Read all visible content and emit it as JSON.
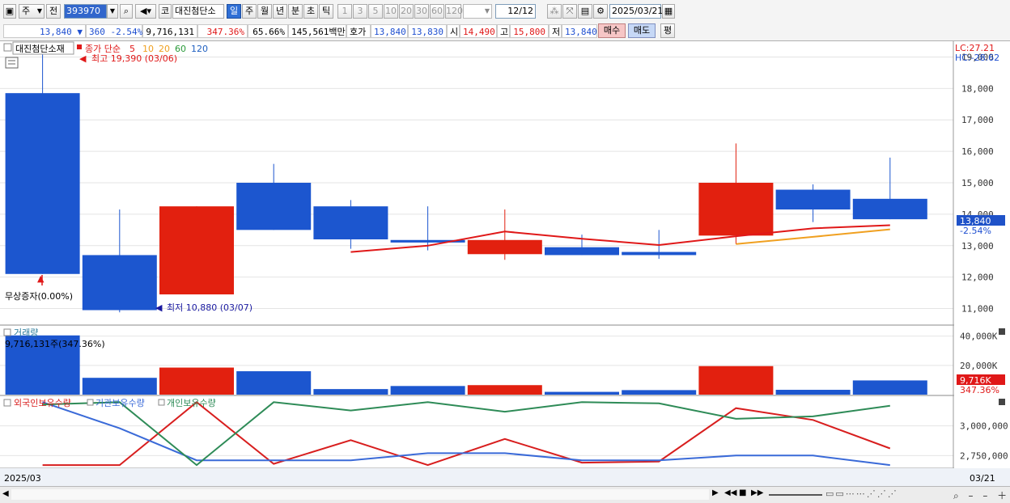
{
  "toolbar": {
    "unit_label": "주",
    "prev_label": "전",
    "code": "393970",
    "stock_name": "대진첨단소",
    "market_btn": "코",
    "periods": [
      "일",
      "주",
      "월",
      "년",
      "분",
      "초",
      "틱"
    ],
    "active_period": "일",
    "intervals": [
      "1",
      "3",
      "5",
      "10",
      "20",
      "30",
      "60",
      "120"
    ],
    "count": "12",
    "count_total": "/12",
    "date": "2025/03/21"
  },
  "quote": {
    "price": "13,840",
    "change_arrow": "▼",
    "change": "360",
    "change_pct": "-2.54%",
    "volume": "9,716,131",
    "volume_pct": "347.36%",
    "ratio": "65.66%",
    "amount": "145,561백만",
    "hoga_label": "호가",
    "ask": "13,840",
    "bid": "13,830",
    "open_label": "시",
    "open": "14,490",
    "high_label": "고",
    "high": "15,800",
    "low_label": "저",
    "low": "13,840",
    "buy_label": "매수",
    "sell_label": "매도",
    "eval_label": "평"
  },
  "price_panel": {
    "name_tag": "대진첨단소재",
    "ma_title": "종가 단순",
    "ma_periods": [
      "5",
      "10",
      "20",
      "60",
      "120"
    ],
    "ma_colors": [
      "#e01818",
      "#f0a020",
      "#f0a020",
      "#2a9a3a",
      "#2060c0"
    ],
    "high_note": "최고 19,390 (03/06)",
    "low_note": "최저 10,880 (03/07)",
    "event_note": "무상증자(0.00%)",
    "lc": "LC:27.21",
    "hc": "HC:-28.62",
    "last_price_tag": "13,840",
    "last_pct_tag": "-2.54%"
  },
  "volume_panel": {
    "title": "거래량",
    "info": "9,716,131주(347.36%)",
    "last_tag": "9,716K",
    "last_pct": "347.36%"
  },
  "holding_panel": {
    "series_labels": [
      "외국인보유수량",
      "기관보유수량",
      "개인보유수량"
    ],
    "colors": [
      "#d81e1e",
      "#3a6ad8",
      "#2e8b57"
    ]
  },
  "axis": {
    "left_date": "2025/03",
    "right_date": "03/21"
  },
  "chart_data": [
    {
      "type": "candlestick",
      "title": "대진첨단소재",
      "ylim": [
        10500,
        19500
      ],
      "yticks": [
        11000,
        12000,
        13000,
        14000,
        15000,
        16000,
        17000,
        18000,
        19000
      ],
      "ytick_labels": [
        "11,000",
        "12,000",
        "13,000",
        "14,000",
        "15,000",
        "16,000",
        "17,000",
        "18,000",
        "19,000"
      ],
      "candles": [
        {
          "open": 17850,
          "high": 19390,
          "low": 12100,
          "close": 12100,
          "up": false
        },
        {
          "open": 12700,
          "high": 14150,
          "low": 10880,
          "close": 10950,
          "up": false
        },
        {
          "open": 11450,
          "high": 14250,
          "low": 11450,
          "close": 14250,
          "up": true
        },
        {
          "open": 15000,
          "high": 15600,
          "low": 13500,
          "close": 13500,
          "up": false
        },
        {
          "open": 14250,
          "high": 14450,
          "low": 12900,
          "close": 13200,
          "up": false
        },
        {
          "open": 13180,
          "high": 14250,
          "low": 12850,
          "close": 13100,
          "up": false
        },
        {
          "open": 12730,
          "high": 14150,
          "low": 12550,
          "close": 13180,
          "up": true
        },
        {
          "open": 12950,
          "high": 13350,
          "low": 12700,
          "close": 12700,
          "up": false
        },
        {
          "open": 12800,
          "high": 13500,
          "low": 12580,
          "close": 12700,
          "up": false
        },
        {
          "open": 13320,
          "high": 16250,
          "low": 13050,
          "close": 15000,
          "up": true
        },
        {
          "open": 14780,
          "high": 14950,
          "low": 13750,
          "close": 14150,
          "up": false
        },
        {
          "open": 14490,
          "high": 15800,
          "low": 13840,
          "close": 13840,
          "up": false
        }
      ],
      "ma5": [
        null,
        null,
        null,
        null,
        12800,
        13000,
        13450,
        13220,
        13020,
        13300,
        13550,
        13650
      ],
      "ma10": [
        null,
        null,
        null,
        null,
        null,
        null,
        null,
        null,
        null,
        13050,
        13280,
        13520
      ]
    },
    {
      "type": "bar",
      "title": "거래량",
      "ylim": [
        0,
        47000
      ],
      "yticks": [
        20000,
        40000
      ],
      "ytick_labels": [
        "20,000K",
        "40,000K"
      ],
      "values": [
        40500,
        11500,
        18500,
        16000,
        3800,
        5900,
        6500,
        1900,
        3100,
        19500,
        3300,
        9716
      ],
      "up": [
        false,
        false,
        true,
        false,
        false,
        false,
        true,
        false,
        false,
        true,
        false,
        false
      ]
    },
    {
      "type": "line",
      "title": "보유수량",
      "ylim": [
        2650000,
        3250000
      ],
      "yticks": [
        2750000,
        3000000
      ],
      "ytick_labels": [
        "2,750,000",
        "3,000,000"
      ],
      "series": [
        {
          "name": "외국인보유수량",
          "values": [
            2670000,
            2670000,
            3200000,
            2680000,
            2880000,
            2670000,
            2890000,
            2690000,
            2700000,
            3150000,
            3050000,
            2810000
          ]
        },
        {
          "name": "기관보유수량",
          "values": [
            3200000,
            2980000,
            2710000,
            2710000,
            2710000,
            2770000,
            2770000,
            2710000,
            2710000,
            2750000,
            2750000,
            2670000
          ]
        },
        {
          "name": "개인보유수량",
          "values": [
            3180000,
            3200000,
            2670000,
            3200000,
            3130000,
            3200000,
            3120000,
            3200000,
            3190000,
            3060000,
            3080000,
            3170000
          ]
        }
      ]
    }
  ]
}
